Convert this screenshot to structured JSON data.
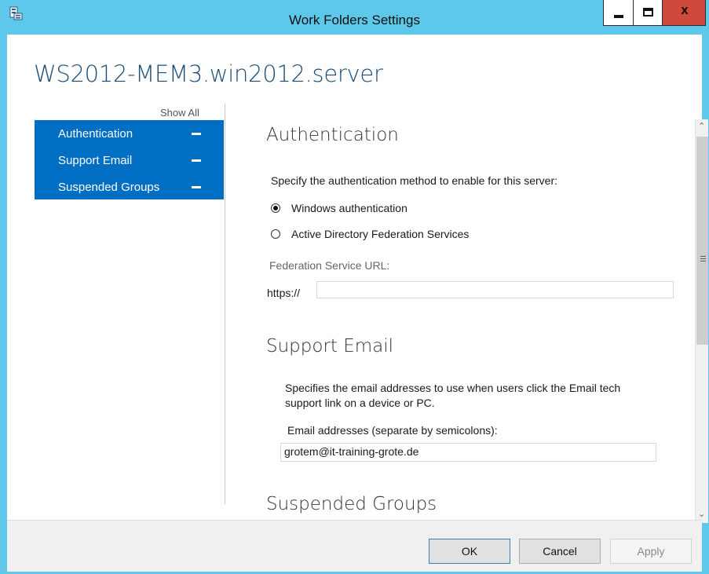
{
  "window": {
    "title": "Work Folders Settings",
    "icon": "server-manager-icon",
    "controls": {
      "minimize": "minimize-icon",
      "maximize": "maximize-icon",
      "close": "x"
    }
  },
  "server_name": "WS2012-MEM3.win2012.server",
  "nav": {
    "show_all": "Show All",
    "items": [
      {
        "label": "Authentication"
      },
      {
        "label": "Support Email"
      },
      {
        "label": "Suspended Groups"
      }
    ]
  },
  "authentication": {
    "title": "Authentication",
    "prompt": "Specify the authentication method to enable for this server:",
    "options": [
      {
        "label": "Windows authentication",
        "selected": true
      },
      {
        "label": "Active Directory Federation Services",
        "selected": false
      }
    ],
    "federation_url_label": "Federation Service URL:",
    "url_prefix": "https://",
    "url_value": ""
  },
  "support_email": {
    "title": "Support Email",
    "description": "Specifies the email addresses to use when users click the Email tech support link on a device or PC.",
    "field_label": "Email addresses (separate by semicolons):",
    "field_value": "grotem@it-training-grote.de"
  },
  "suspended_groups": {
    "title": "Suspended Groups"
  },
  "buttons": {
    "ok": "OK",
    "cancel": "Cancel",
    "apply": "Apply"
  },
  "colors": {
    "title_bar": "#5ec8ea",
    "nav_accent": "#006fc3",
    "close_button": "#d04a3c",
    "server_name": "#1b4d78"
  }
}
